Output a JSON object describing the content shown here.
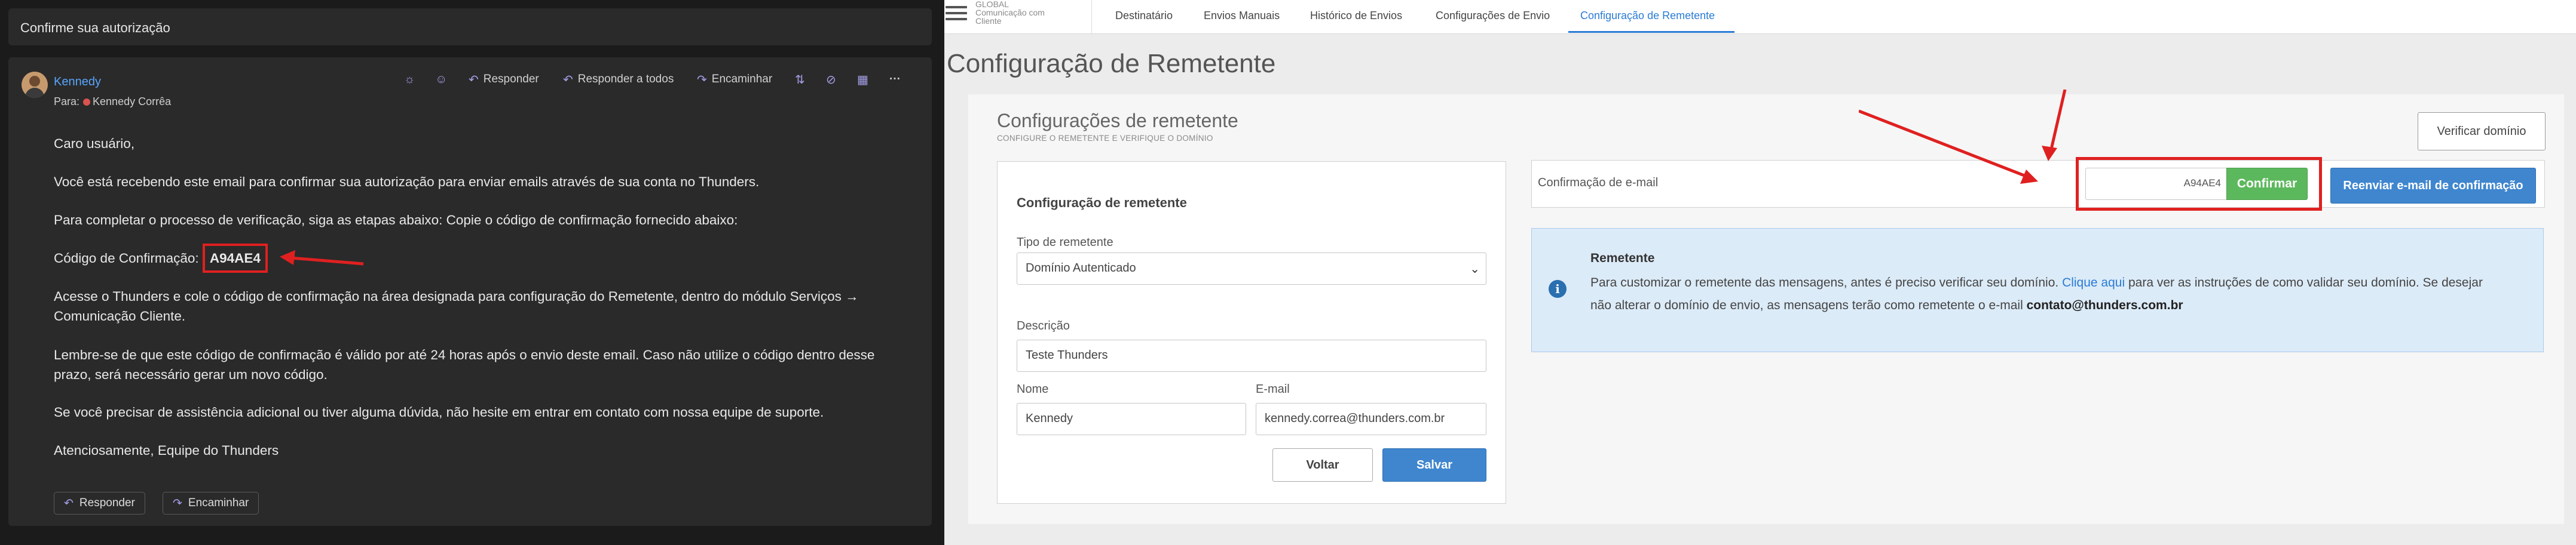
{
  "email": {
    "subject": "Confirme sua autorização",
    "sender": "Kennedy",
    "to_label": "Para:",
    "to_name": "Kennedy Corrêa",
    "toolbar": {
      "reply": "Responder",
      "reply_all": "Responder a todos",
      "forward": "Encaminhar"
    },
    "greeting": "Caro usuário,",
    "p1": "Você está recebendo este email para confirmar sua autorização para enviar emails através de sua conta no Thunders.",
    "p2": "Para completar o processo de verificação, siga as etapas abaixo: Copie o código de confirmação fornecido abaixo:",
    "code_label": "Código de Confirmação:",
    "code": "A94AE4",
    "p3": "Acesse o Thunders e cole o código de confirmação na área designada para configuração do Remetente, dentro do módulo Serviços → Comunicação Cliente.",
    "p4": "Lembre-se de que este código de confirmação é válido por até 24 horas após o envio deste email. Caso não utilize o código dentro desse prazo, será necessário gerar um novo código.",
    "p5": "Se você precisar de assistência adicional ou tiver alguma dúvida, não hesite em entrar em contato com nossa equipe de suporte.",
    "signoff": "Atenciosamente, Equipe do Thunders",
    "footer": {
      "reply": "Responder",
      "forward": "Encaminhar"
    }
  },
  "app": {
    "brand": {
      "line1": "GLOBAL",
      "line2": "Comunicação com",
      "line3": "Cliente"
    },
    "tabs": [
      {
        "label": "Destinatário"
      },
      {
        "label": "Envios Manuais"
      },
      {
        "label": "Histórico de Envios"
      },
      {
        "label": "Configurações de Envio"
      },
      {
        "label": "Configuração de Remetente"
      }
    ],
    "active_tab": 4,
    "page_title": "Configuração de Remetente",
    "card_title": "Configurações de remetente",
    "card_subtitle": "CONFIGURE O REMETENTE E VERIFIQUE O DOMÍNIO",
    "verify_domain_button": "Verificar domínio",
    "form": {
      "title": "Configuração de remetente",
      "type_label": "Tipo de remetente",
      "type_value": "Domínio Autenticado",
      "description_label": "Descrição",
      "description_value": "Teste Thunders",
      "name_label": "Nome",
      "name_value": "Kennedy",
      "email_label": "E-mail",
      "email_value": "kennedy.correa@thunders.com.br",
      "back_button": "Voltar",
      "save_button": "Salvar"
    },
    "confirmation": {
      "label": "Confirmação de e-mail",
      "code_value": "A94AE4",
      "confirm_button": "Confirmar",
      "resend_button": "Reenviar e-mail de confirmação"
    },
    "info": {
      "title": "Remetente",
      "text_before_link": "Para customizar o remetente das mensagens, antes é preciso verificar seu domínio. ",
      "link": "Clique aqui",
      "text_after_link": " para ver as instruções de como validar seu domínio. Se desejar não alterar o domínio de envio, as mensagens terão como remetente o e-mail ",
      "email": "contato@thunders.com.br"
    }
  },
  "colors": {
    "annotation_red": "#e02020",
    "primary_blue": "#3f86cf",
    "confirm_green": "#5cb85c",
    "email_link_blue": "#58a6ff"
  },
  "icons": [
    "sun-icon",
    "emoji-icon",
    "reply-icon",
    "reply-all-icon",
    "forward-icon",
    "apps-icon",
    "link-icon",
    "grid-icon",
    "more-icon",
    "info-icon",
    "menu-icon",
    "chevron-down-icon"
  ]
}
